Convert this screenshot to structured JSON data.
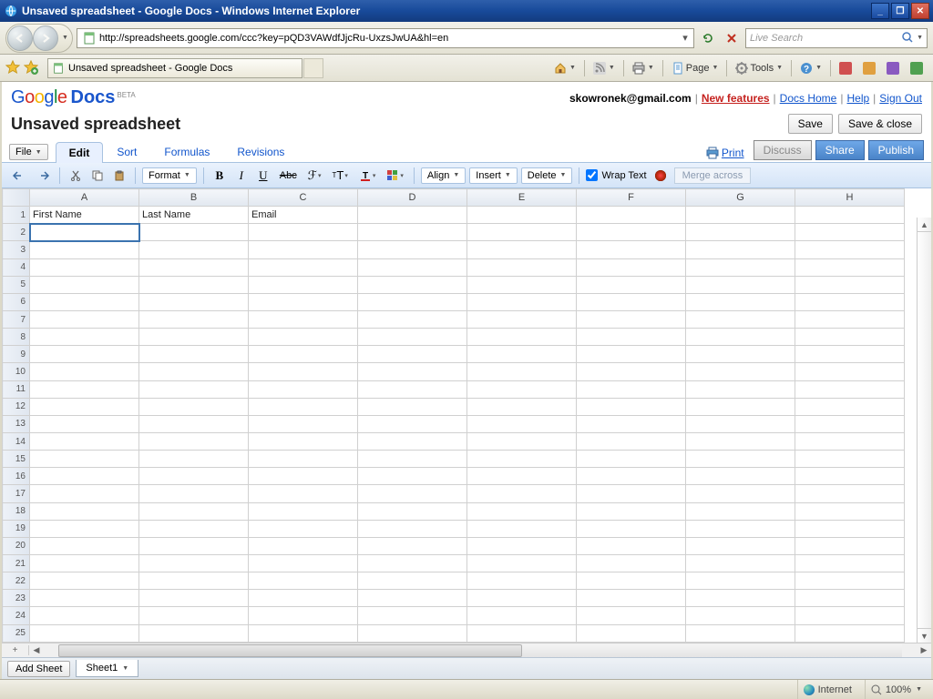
{
  "window": {
    "title": "Unsaved spreadsheet - Google Docs - Windows Internet Explorer"
  },
  "browser": {
    "url": "http://spreadsheets.google.com/ccc?key=pQD3VAWdfJjcRu-UxzsJwUA&hl=en",
    "search_placeholder": "Live Search",
    "tab_title": "Unsaved spreadsheet - Google Docs",
    "cmd_page": "Page",
    "cmd_tools": "Tools"
  },
  "docs": {
    "logo_docs": "Docs",
    "logo_beta": "BETA",
    "user_email": "skowronek@gmail.com",
    "link_new_features": "New features",
    "link_docs_home": "Docs Home",
    "link_help": "Help",
    "link_sign_out": "Sign Out",
    "title": "Unsaved spreadsheet",
    "btn_save": "Save",
    "btn_save_close": "Save & close",
    "file_label": "File",
    "tabs": {
      "edit": "Edit",
      "sort": "Sort",
      "formulas": "Formulas",
      "revisions": "Revisions"
    },
    "link_print": "Print",
    "btn_discuss": "Discuss",
    "btn_share": "Share",
    "btn_publish": "Publish"
  },
  "toolbar": {
    "format": "Format",
    "align": "Align",
    "insert": "Insert",
    "delete": "Delete",
    "wrap_text": "Wrap Text",
    "merge_across": "Merge across"
  },
  "sheet": {
    "columns": [
      "A",
      "B",
      "C",
      "D",
      "E",
      "F",
      "G",
      "H"
    ],
    "data_row1": {
      "A": "First Name",
      "B": "Last Name",
      "C": "Email"
    },
    "selected_cell": "A2",
    "row_count": 25,
    "add_sheet": "Add Sheet",
    "tab_name": "Sheet1"
  },
  "status": {
    "zone": "Internet",
    "zoom": "100%"
  }
}
